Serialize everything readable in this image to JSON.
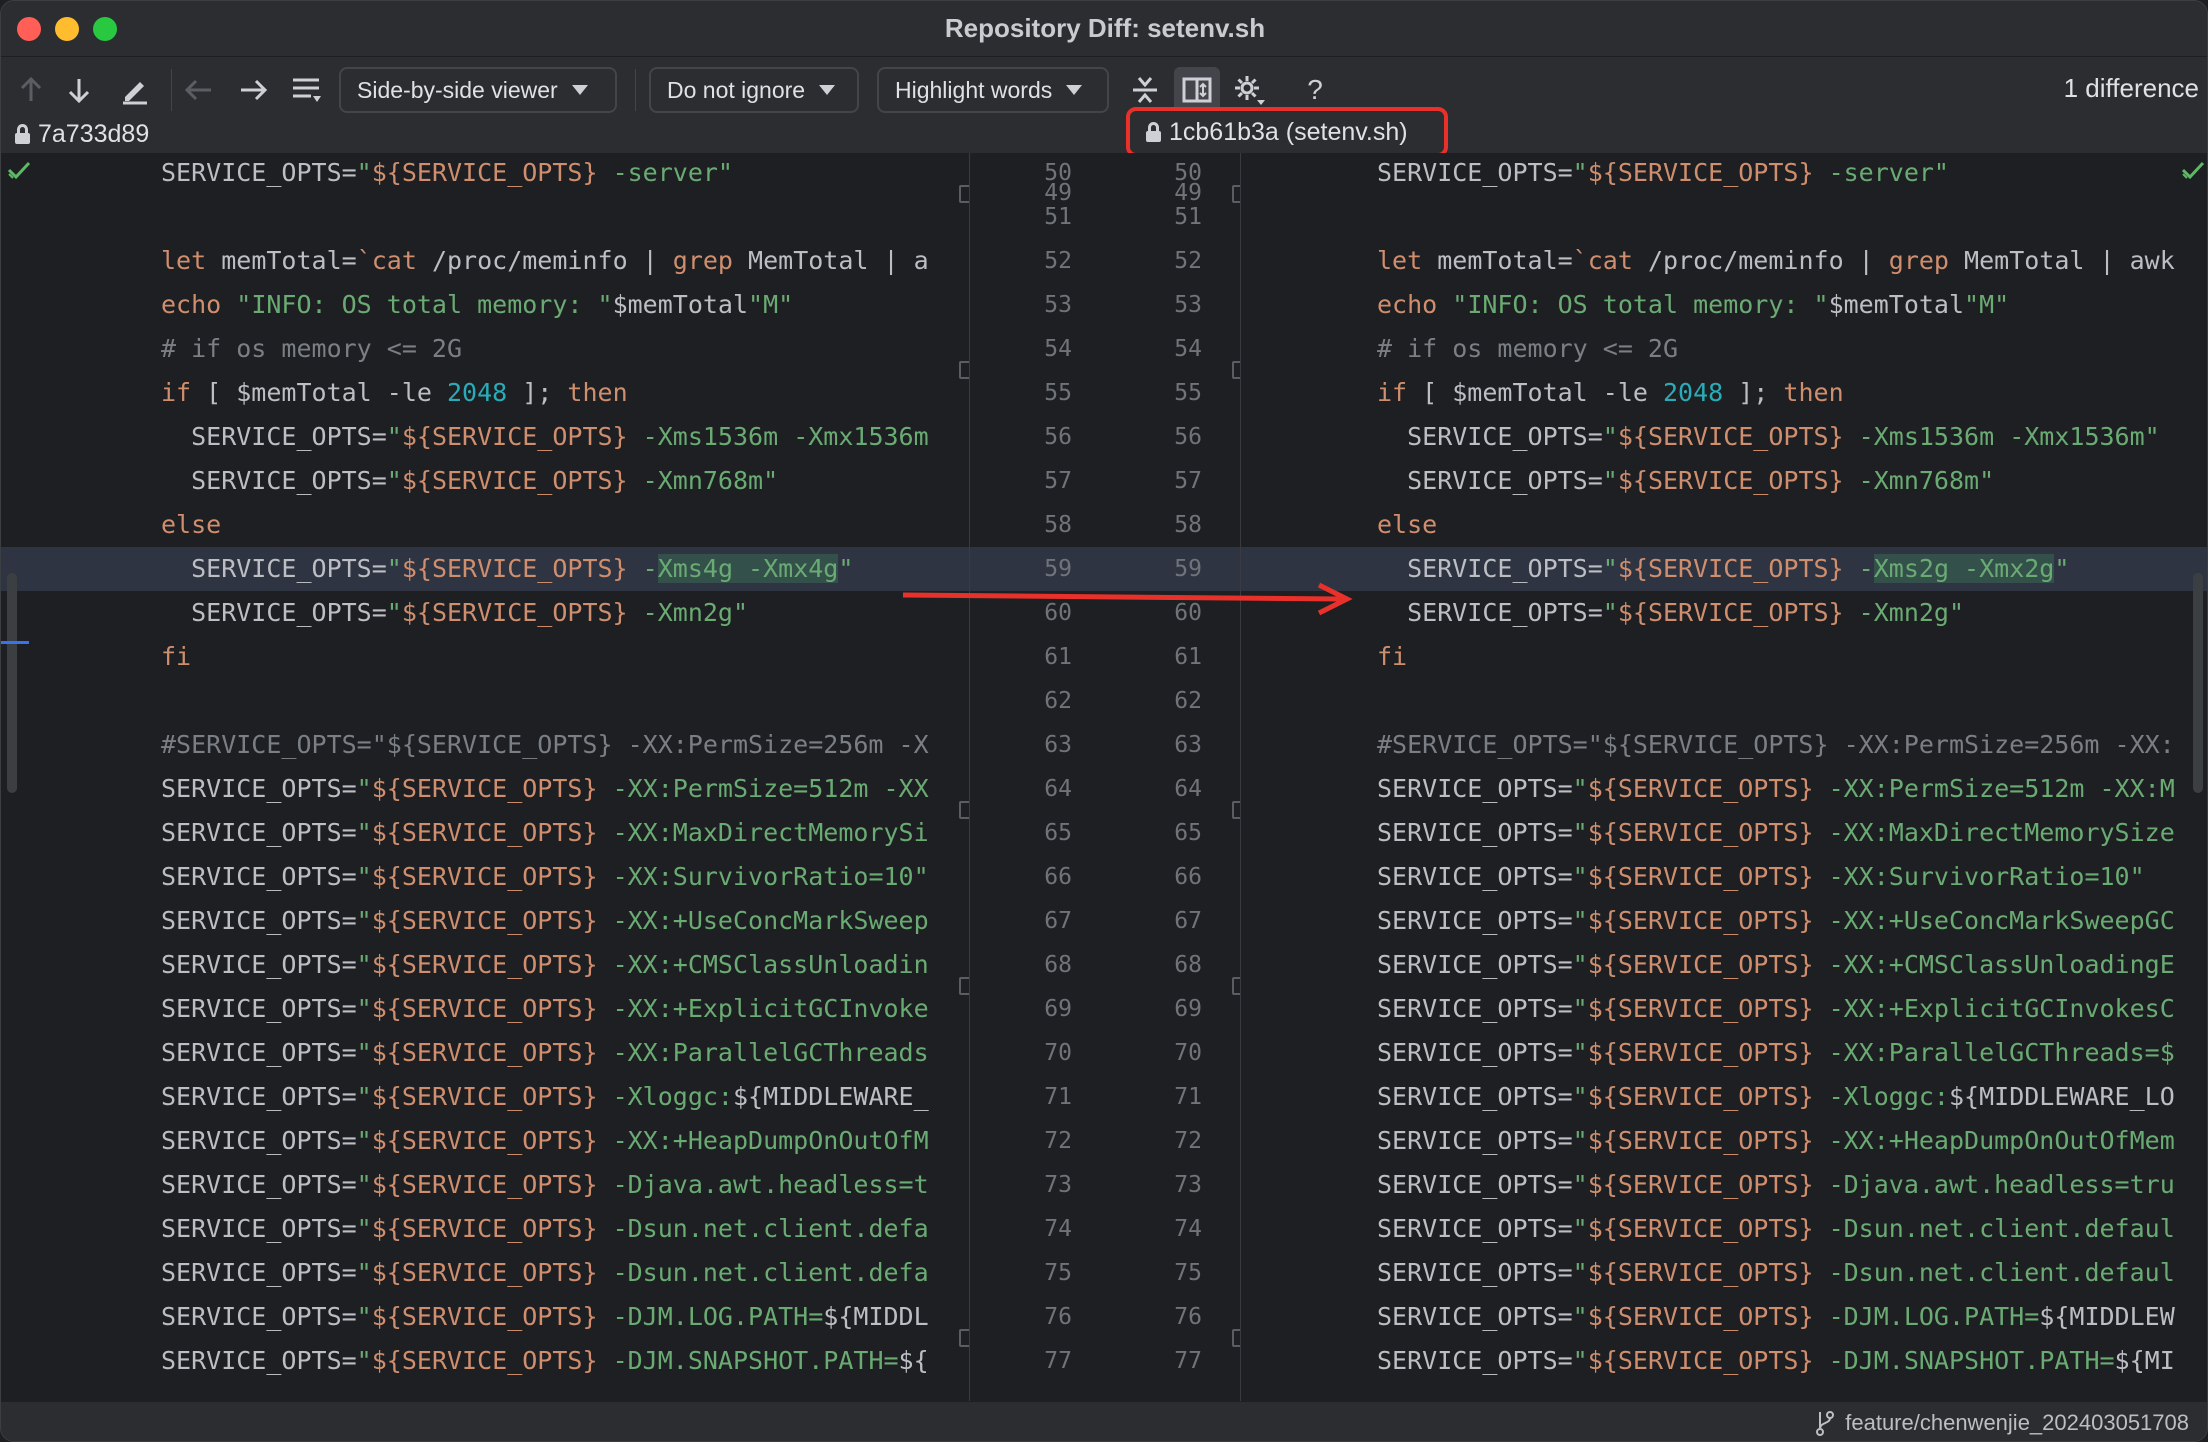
{
  "window": {
    "title": "Repository Diff: setenv.sh"
  },
  "toolbar": {
    "viewer": "Side-by-side viewer",
    "ignore": "Do not ignore",
    "highlight": "Highlight words",
    "help": "?",
    "difference_count": "1 difference"
  },
  "revisions": {
    "left": "7a733d89",
    "right": "1cb61b3a (setenv.sh)"
  },
  "status": {
    "branch": "feature/chenwenjie_202403051708"
  },
  "lines": {
    "partial_top": "49",
    "numbers": [
      "50",
      "51",
      "52",
      "53",
      "54",
      "55",
      "56",
      "57",
      "58",
      "59",
      "60",
      "61",
      "62",
      "63",
      "64",
      "65",
      "66",
      "67",
      "68",
      "69",
      "70",
      "71",
      "72",
      "73",
      "74",
      "75",
      "76",
      "77"
    ]
  },
  "left_code": {
    "l50_a": "SERVICE_OPTS=",
    "l50_b": "\"${SERVICE_OPTS} -server\"",
    "l52_a": "let ",
    "l52_b": "memTotal=",
    "l52_c": "`cat ",
    "l52_d": "/proc/meminfo | ",
    "l52_e": "grep ",
    "l52_f": "MemTotal | a",
    "l53_a": "echo ",
    "l53_b": "\"INFO: OS total memory: \"",
    "l53_c": "$memTotal",
    "l53_d": "\"M\"",
    "l54": "# if os memory <= 2G",
    "l55_a": "if ",
    "l55_b": "[ $memTotal -le ",
    "l55_c": "2048",
    "l55_d": " ]; ",
    "l55_e": "then",
    "l56_a": "  SERVICE_OPTS=",
    "l56_b": "\"",
    "l56_c": "${SERVICE_OPTS}",
    "l56_d": " -Xms1536m -Xmx1536m",
    "l57_a": "  SERVICE_OPTS=",
    "l57_b": "\"",
    "l57_c": "${SERVICE_OPTS}",
    "l57_d": " -Xmn768m\"",
    "l58": "else",
    "l59_a": "  SERVICE_OPTS=",
    "l59_b": "\"",
    "l59_c": "${SERVICE_OPTS}",
    "l59_d": " -",
    "l59_e": "Xms4g -Xmx4g",
    "l59_f": "\"",
    "l60_a": "  SERVICE_OPTS=",
    "l60_b": "\"",
    "l60_c": "${SERVICE_OPTS}",
    "l60_d": " -Xmn2g\"",
    "l61": "fi",
    "l63": "#SERVICE_OPTS=\"${SERVICE_OPTS} -XX:PermSize=256m -X",
    "l64": " -XX:PermSize=512m -XX",
    "l65": " -XX:MaxDirectMemorySi",
    "l66": " -XX:SurvivorRatio=10\"",
    "l67": " -XX:+UseConcMarkSweep",
    "l68": " -XX:+CMSClassUnloadin",
    "l69": " -XX:+ExplicitGCInvoke",
    "l70": " -XX:ParallelGCThreads",
    "l71_a": " -Xloggc:",
    "l71_b": "${MIDDLEWARE_",
    "l72": " -XX:+HeapDumpOnOutOfM",
    "l73": " -Djava.awt.headless=t",
    "l74": " -Dsun.net.client.defa",
    "l75": " -Dsun.net.client.defa",
    "l76_a": " -DJM.LOG.PATH=",
    "l76_b": "${MIDDL",
    "l77_a": " -DJM.SNAPSHOT.PATH=",
    "l77_b": "${"
  },
  "right_code": {
    "l50_a": "SERVICE_OPTS=",
    "l50_b": "\"${SERVICE_OPTS} -server\"",
    "l52_a": "let ",
    "l52_b": "memTotal=",
    "l52_c": "`cat ",
    "l52_d": "/proc/meminfo | ",
    "l52_e": "grep ",
    "l52_f": "MemTotal | awk",
    "l53_a": "echo ",
    "l53_b": "\"INFO: OS total memory: \"",
    "l53_c": "$memTotal",
    "l53_d": "\"M\"",
    "l54": "# if os memory <= 2G",
    "l55_a": "if ",
    "l55_b": "[ $memTotal -le ",
    "l55_c": "2048",
    "l55_d": " ]; ",
    "l55_e": "then",
    "l56_a": "  SERVICE_OPTS=",
    "l56_b": "\"",
    "l56_c": "${SERVICE_OPTS}",
    "l56_d": " -Xms1536m -Xmx1536m\"",
    "l57_a": "  SERVICE_OPTS=",
    "l57_b": "\"",
    "l57_c": "${SERVICE_OPTS}",
    "l57_d": " -Xmn768m\"",
    "l58": "else",
    "l59_a": "  SERVICE_OPTS=",
    "l59_b": "\"",
    "l59_c": "${SERVICE_OPTS}",
    "l59_d": " -",
    "l59_e": "Xms2g -Xmx2g",
    "l59_f": "\"",
    "l60_a": "  SERVICE_OPTS=",
    "l60_b": "\"",
    "l60_c": "${SERVICE_OPTS}",
    "l60_d": " -Xmn2g\"",
    "l61": "fi",
    "l63": "#SERVICE_OPTS=\"${SERVICE_OPTS} -XX:PermSize=256m -XX:",
    "l64": " -XX:PermSize=512m -XX:M",
    "l65": " -XX:MaxDirectMemorySize",
    "l66": " -XX:SurvivorRatio=10\"",
    "l67": " -XX:+UseConcMarkSweepGC",
    "l68": " -XX:+CMSClassUnloadingE",
    "l69": " -XX:+ExplicitGCInvokesC",
    "l70": " -XX:ParallelGCThreads=$",
    "l71_a": " -Xloggc:",
    "l71_b": "${MIDDLEWARE_LO",
    "l72": " -XX:+HeapDumpOnOutOfMem",
    "l73": " -Djava.awt.headless=tru",
    "l74": " -Dsun.net.client.defaul",
    "l75": " -Dsun.net.client.defaul",
    "l76_a": " -DJM.LOG.PATH=",
    "l76_b": "${MIDDLEW",
    "l77_a": " -DJM.SNAPSHOT.PATH=",
    "l77_b": "${MI"
  },
  "tokens": {
    "assign": "SERVICE_OPTS=",
    "quote": "\"",
    "var": "${SERVICE_OPTS}"
  },
  "colors": {
    "keyword": "#cf8e6d",
    "string": "#6aab73",
    "number": "#2aacb8",
    "comment": "#7a7e85",
    "changed_word_bg": "#34504b",
    "changed_line_bg": "#2e3441",
    "annotation_red": "#e8312a"
  }
}
